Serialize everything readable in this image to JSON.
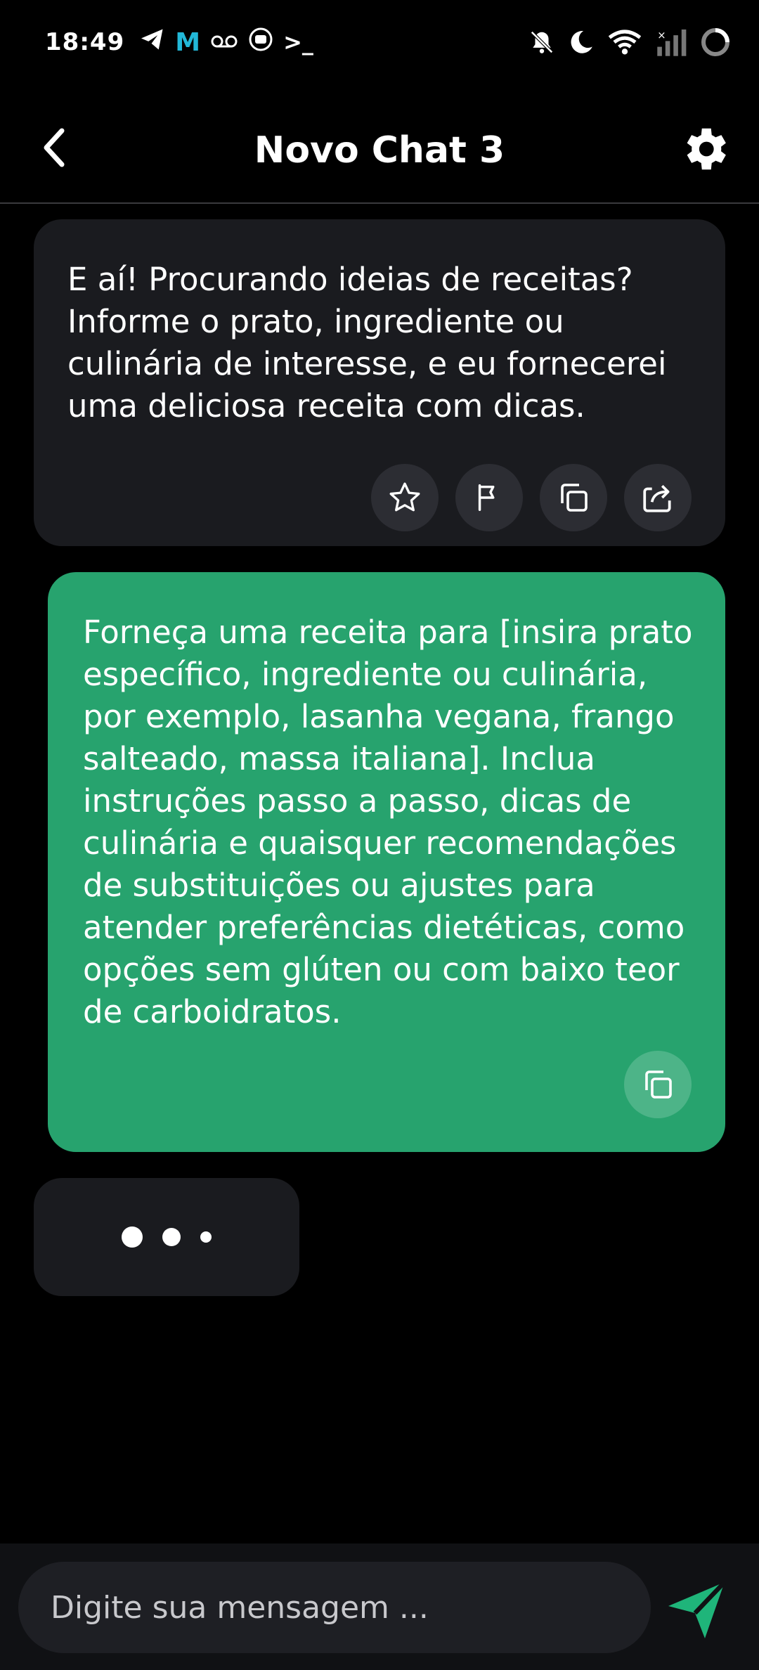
{
  "status_bar": {
    "time": "18:49",
    "left_icons": [
      "telegram-icon",
      "m-app-icon",
      "voicemail-icon",
      "app-icon",
      "terminal-icon"
    ],
    "m_label": "M",
    "terminal_label": ">_",
    "right_icons": [
      "notifications-off-icon",
      "do-not-disturb-icon",
      "wifi-icon",
      "signal-icon",
      "battery-icon"
    ]
  },
  "header": {
    "title": "Novo Chat 3",
    "back_icon": "chevron-left-icon",
    "settings_icon": "gear-icon"
  },
  "messages": [
    {
      "role": "bot",
      "text": "E aí! Procurando ideias de receitas? Informe o prato, ingrediente ou culinária de interesse, e eu fornecerei uma deliciosa receita com dicas.",
      "actions": [
        "star-icon",
        "flag-icon",
        "copy-icon",
        "share-icon"
      ]
    },
    {
      "role": "user",
      "text": "Forneça uma receita para [insira prato específico, ingrediente ou culinária, por exemplo, lasanha vegana, frango salteado, massa italiana]. Inclua instruções passo a passo, dicas de culinária e quaisquer recomendações de substituições ou ajustes para atender preferências dietéticas, como opções sem glúten ou com baixo teor de carboidratos.",
      "actions": [
        "copy-icon"
      ]
    }
  ],
  "typing_indicator": {
    "visible": true
  },
  "input": {
    "placeholder": "Digite sua mensagem ...",
    "value": ""
  },
  "colors": {
    "background": "#000000",
    "bot_bubble": "#1a1b1f",
    "user_bubble": "#27a36e",
    "accent": "#1fb57a"
  }
}
